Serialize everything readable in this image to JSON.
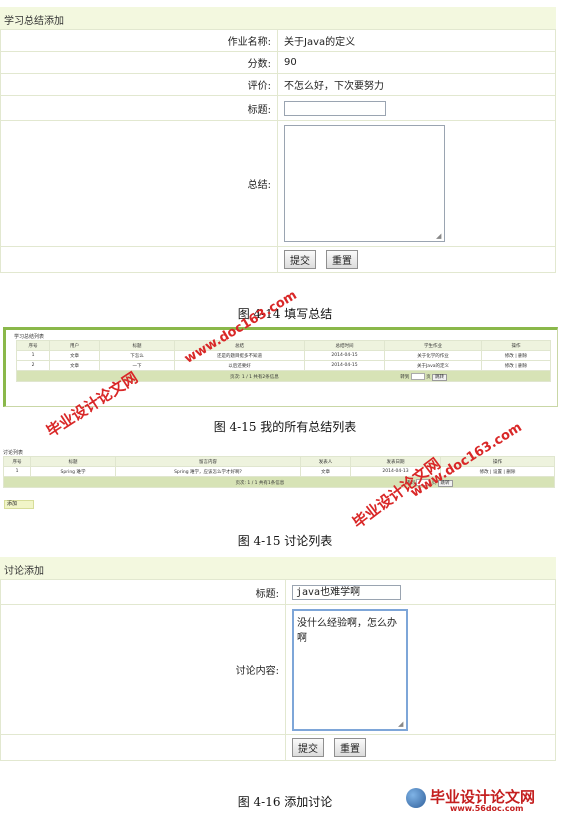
{
  "form1": {
    "title": "学习总结添加",
    "rows": [
      {
        "label": "作业名称:",
        "value": "关于Java的定义"
      },
      {
        "label": "分数:",
        "value": "90"
      },
      {
        "label": "评价:",
        "value": "不怎么好，下次要努力"
      }
    ],
    "title_label": "标题:",
    "summary_label": "总结:",
    "submit": "提交",
    "reset": "重置"
  },
  "caption1": "图 4-14  填写总结",
  "list1": {
    "title": "学习总结列表",
    "headers": [
      "序号",
      "用户",
      "标题",
      "总结",
      "总结时间",
      "学生作业",
      "操作"
    ],
    "rows": [
      [
        "1",
        "文章",
        "下怎么",
        "还是的题目挺多不知道",
        "2014-04-15",
        "关于化学的作业",
        "修改 | 删除"
      ],
      [
        "2",
        "文章",
        "一下",
        "以后还要好",
        "2014-04-15",
        "关于Java的定义",
        "修改 | 删除"
      ]
    ],
    "pager": "页次: 1 / 1 共有2条信息",
    "goto": "转到",
    "page_unit": "页",
    "jump": "跳转"
  },
  "caption2": "图 4-15  我的所有总结列表",
  "list2": {
    "title": "讨论列表",
    "headers": [
      "序号",
      "标题",
      "留言内容",
      "发表人",
      "发表日期",
      "操作"
    ],
    "row": [
      "1",
      "Spring 难学",
      "Spring 难学，应该怎么学才好啊?",
      "文章",
      "2014-04-13",
      "修改 | 设置 | 删除"
    ],
    "pager": "页次: 1 / 1 共有1条信息",
    "goto": "转到",
    "page_unit": "页",
    "jump": "跳转",
    "add": "添加"
  },
  "caption3": "图 4-15  讨论列表",
  "form2": {
    "title": "讨论添加",
    "title_label": "标题:",
    "title_value": "java也难学啊",
    "content_label": "讨论内容:",
    "content_value": "没什么经验啊，怎么办啊",
    "submit": "提交",
    "reset": "重置"
  },
  "caption4": "图 4-16  添加讨论",
  "watermark": {
    "url": "www.doc163.com",
    "brand": "毕业设计论文网",
    "site_brand": "毕业设计论文网",
    "site_url": "www.56doc.com"
  },
  "colors": {
    "header_bg": "#f3f8df",
    "accent_green": "#8ab84a",
    "watermark_red": "#d92727"
  }
}
